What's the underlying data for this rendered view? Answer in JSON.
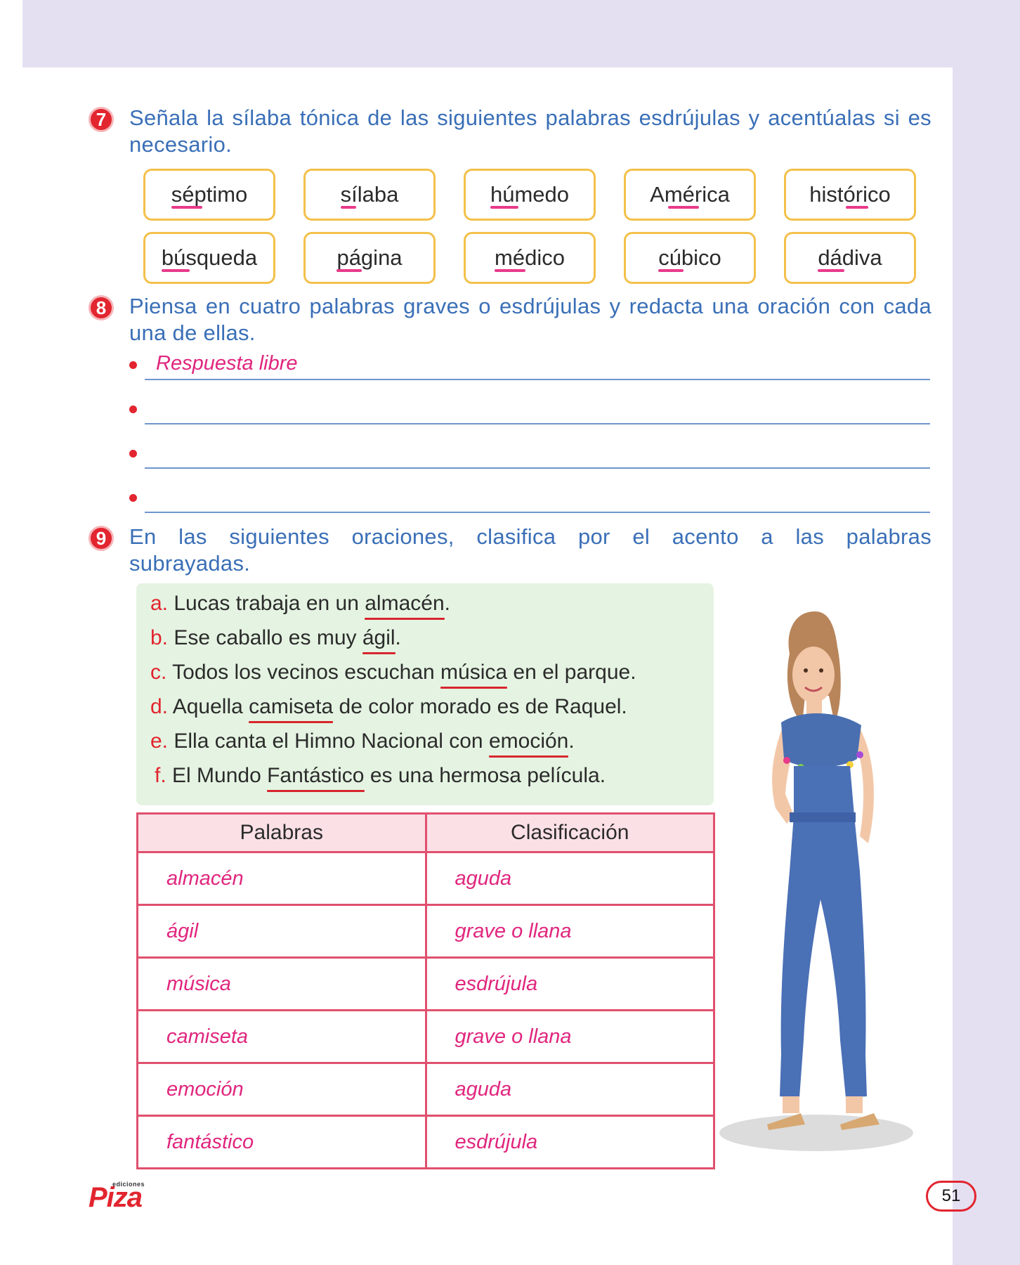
{
  "ex7": {
    "number": "7",
    "text": "Señala la sílaba tónica de las siguientes palabras esdrújulas y acentúalas si es necesario.",
    "words": [
      "séptimo",
      "sílaba",
      "húmedo",
      "América",
      "histórico",
      "búsqueda",
      "página",
      "médico",
      "cúbico",
      "dádiva"
    ]
  },
  "ex8": {
    "number": "8",
    "text": "Piensa en cuatro palabras graves o esdrújulas y redacta una oración con cada una de ellas.",
    "answer": "Respuesta libre"
  },
  "ex9": {
    "number": "9",
    "text": "En las siguientes oraciones, clasifica por el acento a las palabras subrayadas.",
    "sentences": [
      {
        "letter": "a.",
        "before": "Lucas trabaja en un ",
        "word": "almacén",
        "after": "."
      },
      {
        "letter": "b.",
        "before": "Ese caballo es muy ",
        "word": "ágil",
        "after": "."
      },
      {
        "letter": "c.",
        "before": "Todos los vecinos escuchan ",
        "word": "música",
        "after": " en el parque."
      },
      {
        "letter": "d.",
        "before": "Aquella ",
        "word": "camiseta",
        "after": " de color morado es de Raquel."
      },
      {
        "letter": "e.",
        "before": "Ella canta el Himno Nacional con ",
        "word": "emoción",
        "after": "."
      },
      {
        "letter": "f.",
        "before": "El Mundo ",
        "word": "Fantástico",
        "after": " es una hermosa película."
      }
    ],
    "table": {
      "headers": [
        "Palabras",
        "Clasificación"
      ],
      "rows": [
        [
          "almacén",
          "aguda"
        ],
        [
          "ágil",
          "grave o llana"
        ],
        [
          "música",
          "esdrújula"
        ],
        [
          "camiseta",
          "grave o llana"
        ],
        [
          "emoción",
          "aguda"
        ],
        [
          "fantástico",
          "esdrújula"
        ]
      ]
    }
  },
  "footer": {
    "logo_small": "ediciones",
    "logo_main": "Piza",
    "page_number": "51"
  },
  "colors": {
    "accent_red": "#e2252f",
    "instruction_blue": "#3a6fb7",
    "answer_pink": "#e0267e",
    "box_yellow": "#f3c04a",
    "table_border": "#e0506e",
    "green_panel": "#e5f4e2",
    "page_frame": "#e4e0f2"
  }
}
